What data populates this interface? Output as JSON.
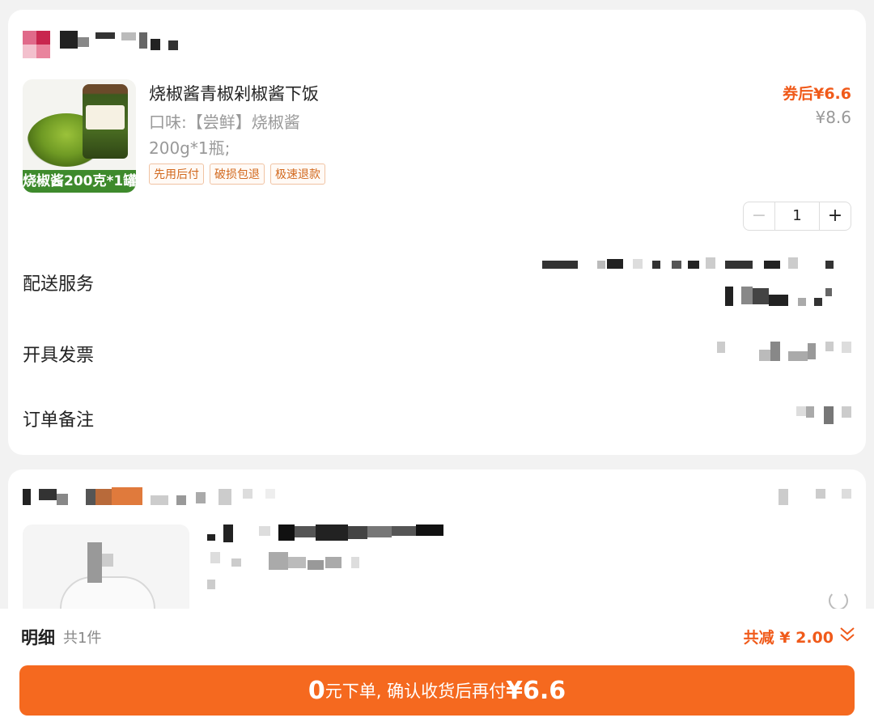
{
  "product": {
    "title": "烧椒酱青椒剁椒酱下饭",
    "spec_flavor": "口味:【尝鲜】烧椒酱",
    "spec_size": "200g*1瓶;",
    "image_banner": "烧椒酱200克*1罐",
    "tags": [
      "先用后付",
      "破损包退",
      "极速退款"
    ],
    "price_after_coupon": "券后¥6.6",
    "price_original": "¥8.6",
    "quantity": "1",
    "minus": "−",
    "plus": "+"
  },
  "rows": {
    "delivery": "配送服务",
    "invoice": "开具发票",
    "note": "订单备注"
  },
  "summary": {
    "detail_label": "明细",
    "item_count": "共1件",
    "discount": "共减 ¥ 2.00"
  },
  "order_button": {
    "amount": "0",
    "text": "元下单, 确认收货后再付",
    "price": "¥6.6"
  },
  "colors": {
    "accent": "#f5691f",
    "price": "#f05a1a",
    "tag_text": "#d2691e"
  }
}
